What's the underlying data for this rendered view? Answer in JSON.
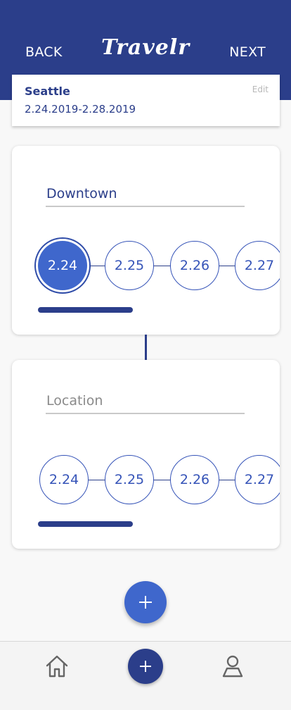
{
  "header": {
    "back_label": "BACK",
    "logo": "Travelr",
    "next_label": "NEXT",
    "background": "#2b3e8a"
  },
  "trip": {
    "city": "Seattle",
    "dates": "2.24.2019-2.28.2019",
    "edit_label": "Edit"
  },
  "stops": [
    {
      "location_value": "Downtown",
      "dates": [
        "2.24",
        "2.25",
        "2.26",
        "2.27"
      ],
      "selected_date": "2.24"
    },
    {
      "location_placeholder": "Location",
      "dates": [
        "2.24",
        "2.25",
        "2.26",
        "2.27"
      ],
      "selected_date": null
    }
  ],
  "fab": {
    "icon": "plus-icon",
    "color": "#3f67cc"
  },
  "bottom_nav": {
    "items": [
      {
        "icon": "home-icon"
      },
      {
        "icon": "plus-icon"
      },
      {
        "icon": "profile-icon"
      }
    ]
  },
  "colors": {
    "primary": "#2b3e8a",
    "accent": "#3f67cc"
  }
}
